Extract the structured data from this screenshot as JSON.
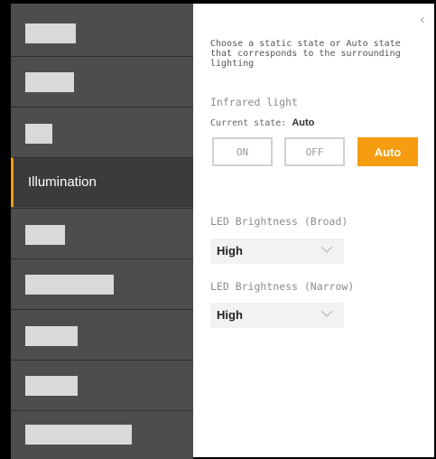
{
  "sidebar": {
    "items": [
      {
        "label": "",
        "redacted": true
      },
      {
        "label": "",
        "redacted": true
      },
      {
        "label": "",
        "redacted": true
      },
      {
        "label": "Illumination",
        "redacted": false,
        "active": true
      },
      {
        "label": "",
        "redacted": true
      },
      {
        "label": "",
        "redacted": true
      },
      {
        "label": "",
        "redacted": true
      },
      {
        "label": "",
        "redacted": true
      },
      {
        "label": "",
        "redacted": true
      }
    ]
  },
  "panel": {
    "close_glyph": "‹",
    "description": "Choose a static state or Auto state that corresponds to the surrounding lighting",
    "infrared": {
      "title": "Infrared light",
      "current_state_label": "Current state:",
      "current_state_value": "Auto",
      "buttons": {
        "on": "ON",
        "off": "OFF",
        "auto": "Auto"
      },
      "selected": "Auto"
    },
    "led_broad": {
      "title": "LED Brightness (Broad)",
      "value": "High"
    },
    "led_narrow": {
      "title": "LED Brightness (Narrow)",
      "value": "High"
    }
  },
  "colors": {
    "accent": "#f59c10",
    "sidebar_bg": "#4d4d4d",
    "sidebar_active_bg": "#3b3b3b",
    "redaction": "#d9d9d9"
  },
  "icons": {
    "close": "chevron-left-icon",
    "dropdown": "chevron-down-icon"
  }
}
